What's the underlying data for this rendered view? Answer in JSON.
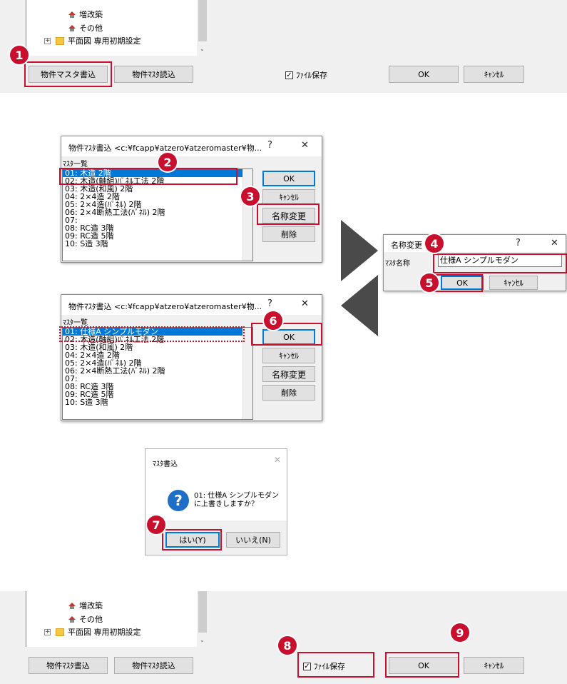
{
  "top_panel": {
    "tree": [
      "増改築",
      "その他",
      "平面図 専用初期設定"
    ],
    "write_button": "物件マスタ書込",
    "read_button": "物件ﾏｽﾀ読込",
    "file_save": "ﾌｧｲﾙ保存",
    "ok": "OK",
    "cancel": "ｷｬﾝｾﾙ"
  },
  "dialog1": {
    "title": "物件ﾏｽﾀ書込 <c:¥fcapp¥atzero¥atzeromaster¥物...",
    "help": "?",
    "close": "✕",
    "list_label": "ﾏｽﾀ一覧",
    "items": [
      "01: 木造 2階",
      "02: 木造(軸組)ﾊﾟﾈﾙ工法 2階",
      "03: 木造(和風) 2階",
      "04: 2×4造 2階",
      "05: 2×4造(ﾊﾟﾈﾙ) 2階",
      "06: 2×4断熱工法(ﾊﾟﾈﾙ) 2階",
      "07:",
      "08: RC造 3階",
      "09: RC造 5階",
      "10: S造 3階"
    ],
    "ok": "OK",
    "cancel": "ｷｬﾝｾﾙ",
    "rename": "名称変更",
    "delete": "削除"
  },
  "rename_dialog": {
    "title": "名称変更",
    "help": "?",
    "close": "✕",
    "label": "ﾏｽﾀ名称",
    "value": "仕様A シンプルモダン",
    "ok": "OK",
    "cancel": "ｷｬﾝｾﾙ"
  },
  "dialog2": {
    "title": "物件ﾏｽﾀ書込 <c:¥fcapp¥atzero¥atzeromaster¥物...",
    "help": "?",
    "close": "✕",
    "list_label": "ﾏｽﾀ一覧",
    "items": [
      "01: 仕様A シンプルモダン",
      "02: 木造(軸組)ﾊﾟﾈﾙ工法 2階",
      "03: 木造(和風) 2階",
      "04: 2×4造 2階",
      "05: 2×4造(ﾊﾟﾈﾙ) 2階",
      "06: 2×4断熱工法(ﾊﾟﾈﾙ) 2階",
      "07:",
      "08: RC造 3階",
      "09: RC造 5階",
      "10: S造 3階"
    ],
    "ok": "OK",
    "cancel": "ｷｬﾝｾﾙ",
    "rename": "名称変更",
    "delete": "削除"
  },
  "confirm": {
    "title": "ﾏｽﾀ書込",
    "close": "✕",
    "line1": "01: 仕様A シンプルモダン",
    "line2": "に上書きしますか？",
    "yes": "はい(Y)",
    "no": "いいえ(N)"
  },
  "bottom_panel": {
    "tree": [
      "増改築",
      "その他",
      "平面図 専用初期設定"
    ],
    "write_button": "物件ﾏｽﾀ書込",
    "read_button": "物件ﾏｽﾀ読込",
    "file_save": "ﾌｧｲﾙ保存",
    "ok": "OK",
    "cancel": "ｷｬﾝｾﾙ"
  },
  "steps": [
    "1",
    "2",
    "3",
    "4",
    "5",
    "6",
    "7",
    "8",
    "9"
  ],
  "colors": {
    "highlight": "#c8102e",
    "selection": "#0078d7",
    "panel": "#f0f0f0"
  }
}
